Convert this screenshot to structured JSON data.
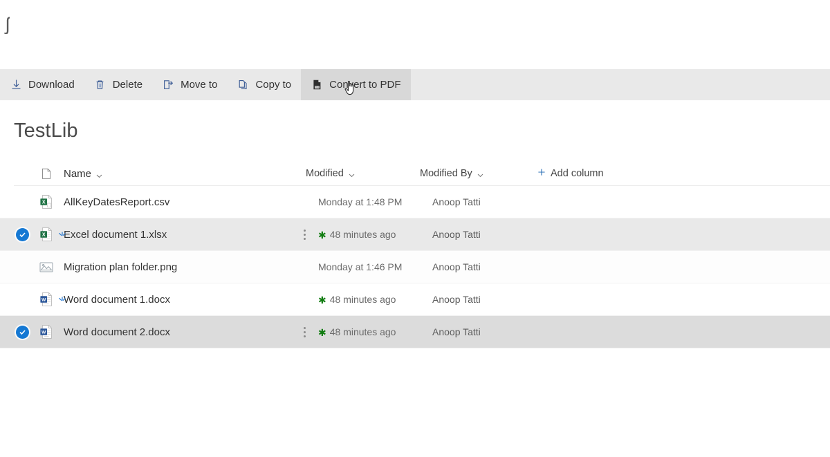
{
  "artifact": {
    "glyph": "ʃ"
  },
  "toolbar": {
    "items": [
      {
        "label": "Download",
        "icon": "download-icon",
        "active": false
      },
      {
        "label": "Delete",
        "icon": "trash-icon",
        "active": false
      },
      {
        "label": "Move to",
        "icon": "move-to-icon",
        "active": false
      },
      {
        "label": "Copy to",
        "icon": "copy-to-icon",
        "active": false
      },
      {
        "label": "Convert to PDF",
        "icon": "pdf-file-icon",
        "active": true
      }
    ]
  },
  "library": {
    "title": "TestLib"
  },
  "table": {
    "headers": {
      "file_type": "",
      "name": "Name",
      "modified": "Modified",
      "modified_by": "Modified By",
      "add_column": "Add column"
    },
    "rows": [
      {
        "name": "AllKeyDatesReport.csv",
        "icon": "excel-file-icon",
        "modified": "Monday at 1:48 PM",
        "modified_by": "Anoop Tatti",
        "selected": false,
        "is_new": false,
        "has_green_star": false,
        "show_ellipsis": false,
        "hovered": false,
        "faint": false
      },
      {
        "name": "Excel document 1.xlsx",
        "icon": "excel-file-icon",
        "modified": "48 minutes ago",
        "modified_by": "Anoop Tatti",
        "selected": true,
        "is_new": true,
        "has_green_star": true,
        "show_ellipsis": true,
        "hovered": false,
        "faint": false
      },
      {
        "name": "Migration plan folder.png",
        "icon": "image-file-icon",
        "modified": "Monday at 1:46 PM",
        "modified_by": "Anoop Tatti",
        "selected": false,
        "is_new": false,
        "has_green_star": false,
        "show_ellipsis": false,
        "hovered": false,
        "faint": true
      },
      {
        "name": "Word document 1.docx",
        "icon": "word-file-icon",
        "modified": "48 minutes ago",
        "modified_by": "Anoop Tatti",
        "selected": false,
        "is_new": true,
        "has_green_star": true,
        "show_ellipsis": false,
        "hovered": false,
        "faint": false
      },
      {
        "name": "Word document 2.docx",
        "icon": "word-file-icon",
        "modified": "48 minutes ago",
        "modified_by": "Anoop Tatti",
        "selected": true,
        "is_new": false,
        "has_green_star": true,
        "show_ellipsis": true,
        "hovered": true,
        "faint": false
      }
    ]
  },
  "colors": {
    "toolbar_bg": "#e9e9e9",
    "toolbar_active_bg": "#d8d8d8",
    "selection_blue": "#1578d3",
    "excel_green": "#217346",
    "word_blue": "#2b579a",
    "new_star_green": "#107c10",
    "row_selected_bg": "#e9e9e9"
  },
  "cursor": {
    "type": "pointer-hand-cursor"
  }
}
